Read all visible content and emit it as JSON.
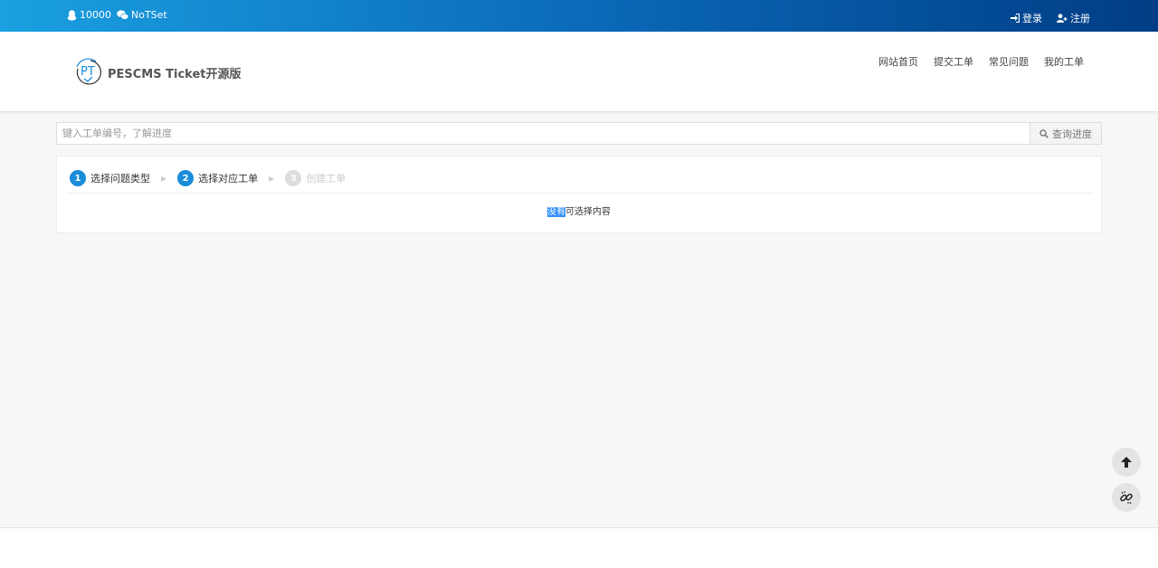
{
  "topbar": {
    "qq_number": "10000",
    "wechat": "NoTSet",
    "login": "登录",
    "register": "注册"
  },
  "header": {
    "logo_mark": "PT",
    "logo_text": "PESCMS Ticket开源版",
    "nav": [
      "网站首页",
      "提交工单",
      "常见问题",
      "我的工单"
    ]
  },
  "search": {
    "placeholder": "键入工单编号，了解进度",
    "button_label": "查询进度"
  },
  "steps": [
    {
      "num": "1",
      "label": "选择问题类型"
    },
    {
      "num": "2",
      "label": "选择对应工单"
    },
    {
      "num": "3",
      "label": "创建工单"
    }
  ],
  "steps_separator": "▶",
  "empty": {
    "highlighted": "没有",
    "rest": "可选择内容"
  },
  "colors": {
    "accent": "#1a8cd8",
    "topbar_start": "#1aa0e0",
    "topbar_end": "#003d85"
  },
  "icons": {
    "qq": "qq-icon",
    "wechat": "wechat-icon",
    "login": "sign-in-icon",
    "register": "user-plus-icon",
    "search": "search-icon",
    "back_to_top": "arrow-up-icon",
    "unlink": "unlink-icon"
  }
}
